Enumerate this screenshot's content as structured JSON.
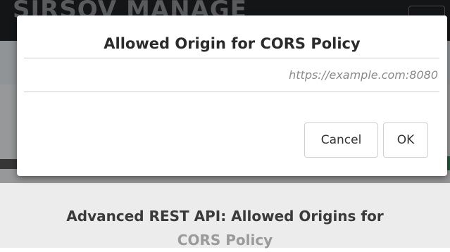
{
  "background": {
    "brand_text": "SIRSOV MANAGE",
    "page_title_line1": "Advanced REST API: Allowed Origins for",
    "page_title_line2": "CORS Policy"
  },
  "dialog": {
    "title": "Allowed Origin for CORS Policy",
    "origin_input": {
      "placeholder": "https://example.com:8080",
      "value": ""
    },
    "cancel_label": "Cancel",
    "ok_label": "OK"
  }
}
